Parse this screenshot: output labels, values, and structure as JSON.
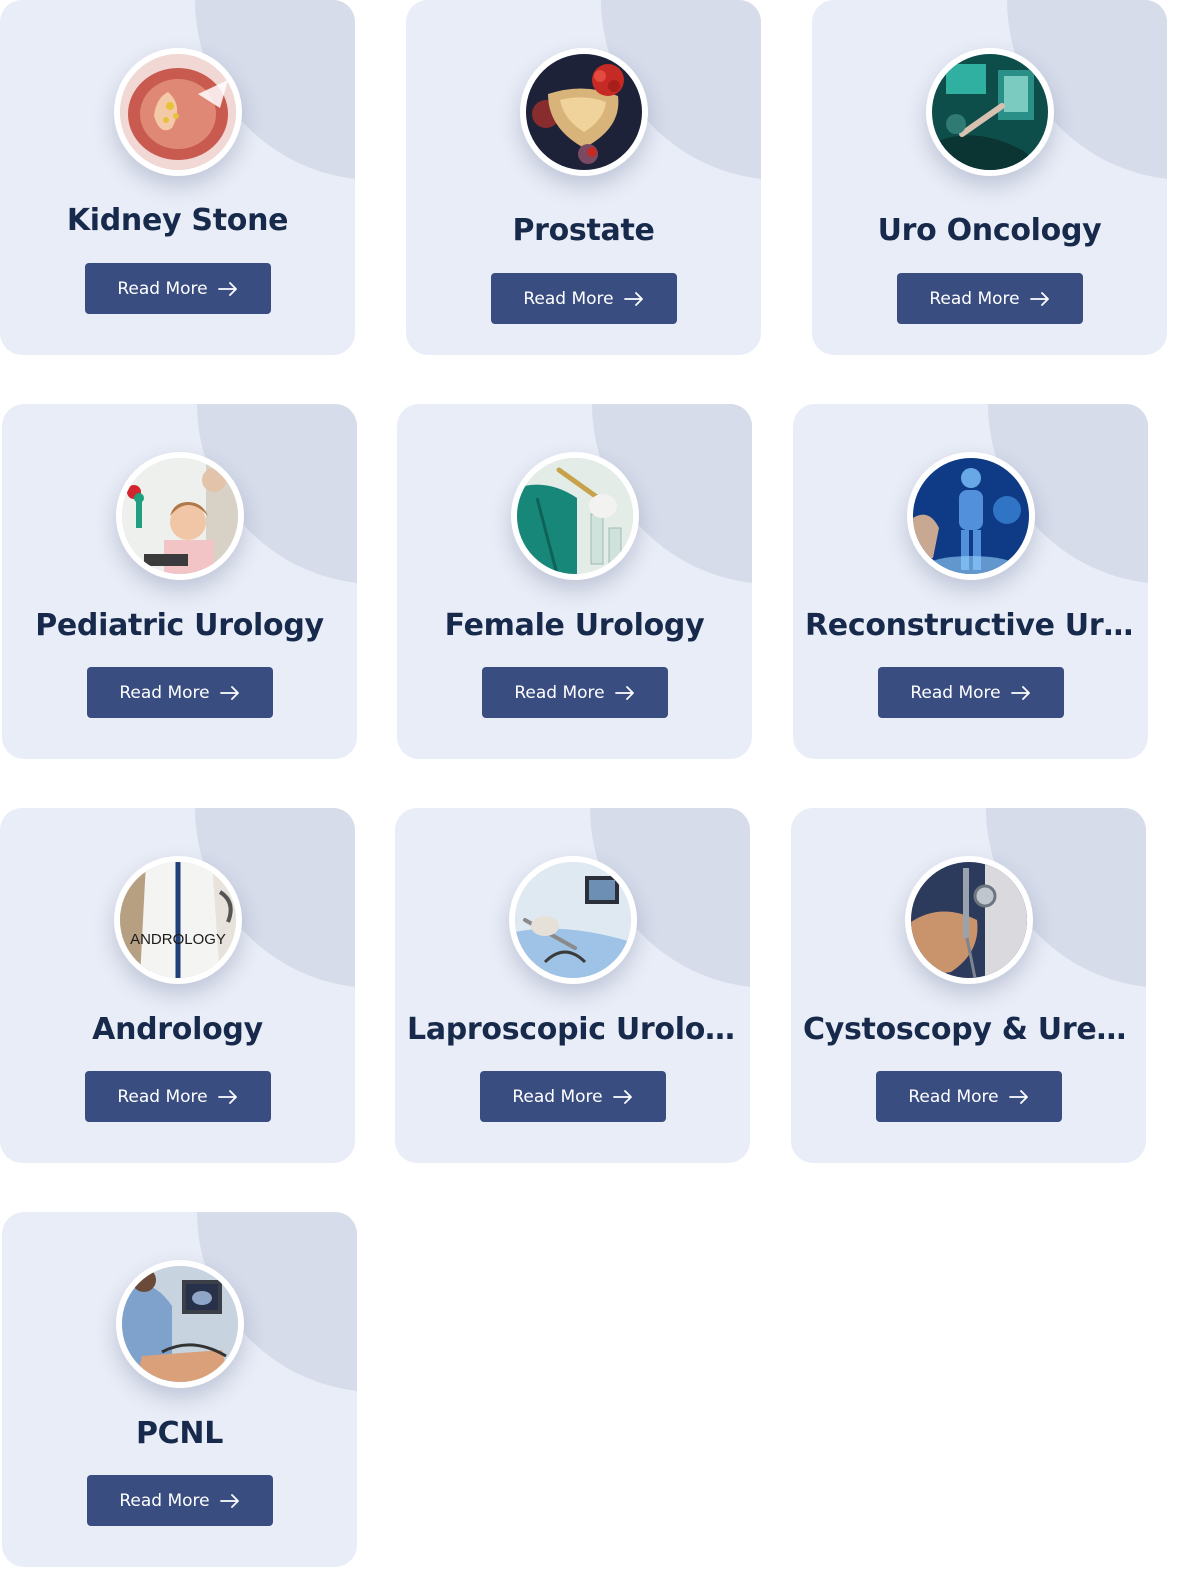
{
  "colors": {
    "card_background": "#e9edf7",
    "card_blob": "#d6dcea",
    "title_text": "#172a4c",
    "button_background": "#394d81",
    "button_text": "#ffffff"
  },
  "cards": [
    {
      "title": "Kidney Stone",
      "button_label": "Read More",
      "image": "kidney-stone-illustration",
      "arrow_icon": "arrow-right-icon"
    },
    {
      "title": "Prostate",
      "button_label": "Read More",
      "image": "prostate-illustration",
      "arrow_icon": "arrow-right-icon"
    },
    {
      "title": "Uro Oncology",
      "button_label": "Read More",
      "image": "operating-room-photo",
      "arrow_icon": "arrow-right-icon"
    },
    {
      "title": "Pediatric Urology",
      "button_label": "Read More",
      "image": "child-with-doctor-photo",
      "arrow_icon": "arrow-right-icon"
    },
    {
      "title": "Female Urology",
      "button_label": "Read More",
      "image": "lab-test-tube-photo",
      "arrow_icon": "arrow-right-icon"
    },
    {
      "title": "Reconstructive Urol...",
      "button_label": "Read More",
      "image": "digital-xray-body-photo",
      "arrow_icon": "arrow-right-icon"
    },
    {
      "title": "Andrology",
      "button_label": "Read More",
      "image": "andrology-doctor-photo",
      "image_text": "ANDROLOGY",
      "arrow_icon": "arrow-right-icon"
    },
    {
      "title": "Laproscopic Urology",
      "button_label": "Read More",
      "image": "laparoscopic-surgery-photo",
      "arrow_icon": "arrow-right-icon"
    },
    {
      "title": "Cystoscopy & Urete...",
      "button_label": "Read More",
      "image": "cystoscope-instrument-photo",
      "arrow_icon": "arrow-right-icon"
    },
    {
      "title": "PCNL",
      "button_label": "Read More",
      "image": "pcnl-surgeon-photo",
      "arrow_icon": "arrow-right-icon"
    }
  ]
}
